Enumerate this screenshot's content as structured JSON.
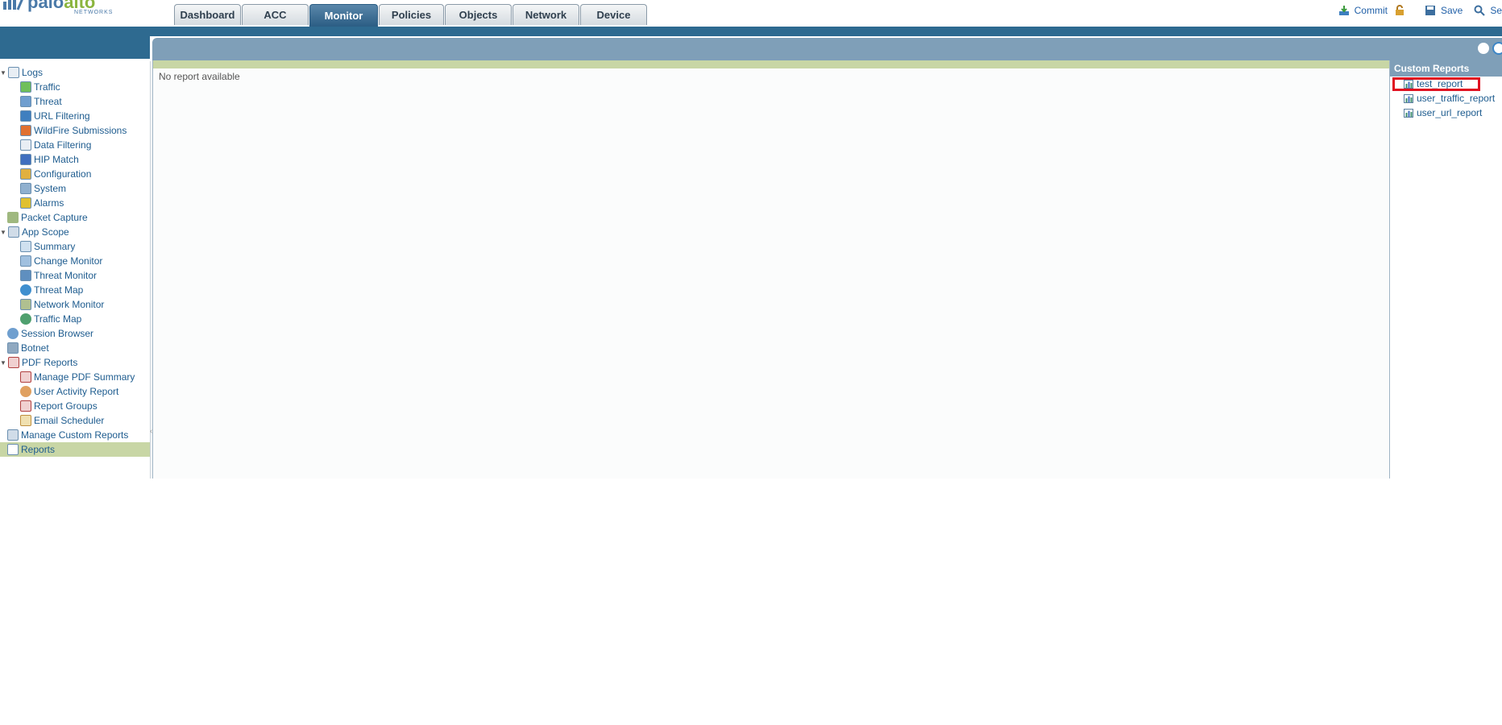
{
  "app": {
    "logo": {
      "brand_a": "palo",
      "brand_b": "alto",
      "sub": "NETWORKS"
    },
    "tabs": [
      {
        "label": "Dashboard",
        "active": false
      },
      {
        "label": "ACC",
        "active": false
      },
      {
        "label": "Monitor",
        "active": true
      },
      {
        "label": "Policies",
        "active": false
      },
      {
        "label": "Objects",
        "active": false
      },
      {
        "label": "Network",
        "active": false
      },
      {
        "label": "Device",
        "active": false
      }
    ],
    "actions": {
      "commit": "Commit",
      "save": "Save",
      "search": "Se"
    }
  },
  "sidebar": {
    "items": [
      {
        "label": "Logs",
        "icon": "logs-icon"
      },
      {
        "label": "Traffic",
        "icon": "traffic-icon"
      },
      {
        "label": "Threat",
        "icon": "threat-icon"
      },
      {
        "label": "URL Filtering",
        "icon": "url-filtering-icon"
      },
      {
        "label": "WildFire Submissions",
        "icon": "wildfire-icon"
      },
      {
        "label": "Data Filtering",
        "icon": "data-filtering-icon"
      },
      {
        "label": "HIP Match",
        "icon": "hip-match-icon"
      },
      {
        "label": "Configuration",
        "icon": "configuration-icon"
      },
      {
        "label": "System",
        "icon": "system-icon"
      },
      {
        "label": "Alarms",
        "icon": "alarms-icon"
      },
      {
        "label": "Packet Capture",
        "icon": "packet-capture-icon"
      },
      {
        "label": "App Scope",
        "icon": "app-scope-icon"
      },
      {
        "label": "Summary",
        "icon": "summary-icon"
      },
      {
        "label": "Change Monitor",
        "icon": "change-monitor-icon"
      },
      {
        "label": "Threat Monitor",
        "icon": "threat-monitor-icon"
      },
      {
        "label": "Threat Map",
        "icon": "threat-map-icon"
      },
      {
        "label": "Network Monitor",
        "icon": "network-monitor-icon"
      },
      {
        "label": "Traffic Map",
        "icon": "traffic-map-icon"
      },
      {
        "label": "Session Browser",
        "icon": "session-browser-icon"
      },
      {
        "label": "Botnet",
        "icon": "botnet-icon"
      },
      {
        "label": "PDF Reports",
        "icon": "pdf-reports-icon"
      },
      {
        "label": "Manage PDF Summary",
        "icon": "pdf-summary-icon"
      },
      {
        "label": "User Activity Report",
        "icon": "user-activity-icon"
      },
      {
        "label": "Report Groups",
        "icon": "report-groups-icon"
      },
      {
        "label": "Email Scheduler",
        "icon": "email-scheduler-icon"
      },
      {
        "label": "Manage Custom Reports",
        "icon": "custom-reports-icon"
      },
      {
        "label": "Reports",
        "icon": "reports-icon"
      }
    ]
  },
  "main": {
    "message": "No report available"
  },
  "custom_reports": {
    "title": "Custom Reports",
    "items": [
      "test_report",
      "user_traffic_report",
      "user_url_report"
    ]
  },
  "colors": {
    "accent": "#2e6a90",
    "selected": "#c8d6a5",
    "highlight": "#e01020",
    "link": "#1e5c8f"
  }
}
